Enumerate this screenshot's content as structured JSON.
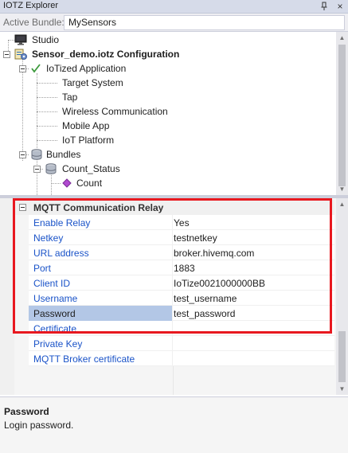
{
  "window": {
    "title": "IOTZ Explorer",
    "close_glyph": "×",
    "pin_icon": "pin-icon"
  },
  "bundle": {
    "label": "Active Bundle:",
    "selected": "MySensors"
  },
  "tree": {
    "nodes": [
      {
        "label": "Studio",
        "icon": "monitor-icon",
        "bold": false
      },
      {
        "label": "Sensor_demo.iotz Configuration",
        "icon": "configuration-icon",
        "bold": true
      },
      {
        "label": "IoTized Application",
        "icon": "application-check-icon",
        "bold": false
      },
      {
        "label": "Target System",
        "icon": "",
        "bold": false
      },
      {
        "label": "Tap",
        "icon": "",
        "bold": false
      },
      {
        "label": "Wireless Communication",
        "icon": "",
        "bold": false
      },
      {
        "label": "Mobile App",
        "icon": "",
        "bold": false
      },
      {
        "label": "IoT Platform",
        "icon": "",
        "bold": false
      },
      {
        "label": "Bundles",
        "icon": "database-icon",
        "bold": false
      },
      {
        "label": "Count_Status",
        "icon": "database-icon",
        "bold": false
      },
      {
        "label": "Count",
        "icon": "diamond-icon",
        "bold": false
      }
    ]
  },
  "properties": {
    "category": "MQTT Communication Relay",
    "rows": [
      {
        "name": "Enable Relay",
        "value": "Yes"
      },
      {
        "name": "Netkey",
        "value": "testnetkey"
      },
      {
        "name": "URL address",
        "value": "broker.hivemq.com"
      },
      {
        "name": "Port",
        "value": "1883"
      },
      {
        "name": "Client ID",
        "value": "IoTize0021000000BB"
      },
      {
        "name": "Username",
        "value": "test_username"
      },
      {
        "name": "Password",
        "value": "test_password"
      },
      {
        "name": "Certificate",
        "value": ""
      },
      {
        "name": "Private Key",
        "value": ""
      },
      {
        "name": "MQTT Broker certificate",
        "value": ""
      }
    ],
    "selected_row": "Password",
    "highlight_color": "#e8181f"
  },
  "description": {
    "title": "Password",
    "text": "Login password."
  },
  "colors": {
    "property_name": "#1a53c8",
    "selected_row": "#b3c7e6",
    "titlebar": "#d6dbe9"
  }
}
